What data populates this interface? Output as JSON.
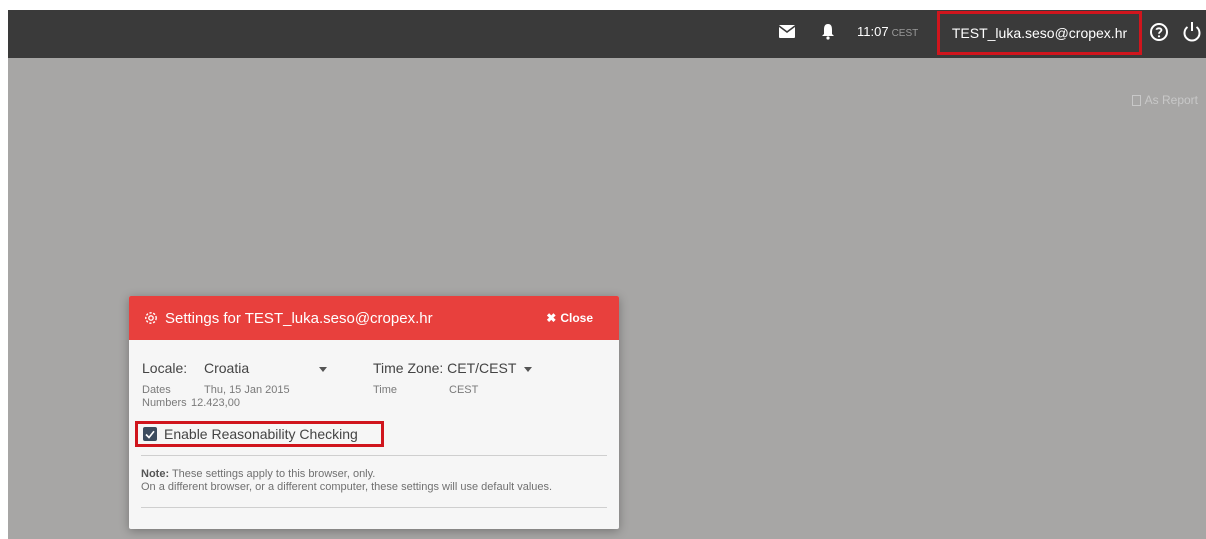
{
  "topbar": {
    "time": "11:07",
    "tz": "CEST",
    "user": "TEST_luka.seso@cropex.hr"
  },
  "content": {
    "as_report": "As Report"
  },
  "dialog": {
    "title": "Settings for TEST_luka.seso@cropex.hr",
    "close_label": "Close",
    "locale_label": "Locale:",
    "locale_value": "Croatia",
    "timezone_label": "Time Zone: CET/CEST",
    "dates_label": "Dates",
    "dates_value": "Thu, 15 Jan 2015",
    "numbers_label": "Numbers",
    "numbers_value": "12.423,00",
    "time_label": "Time",
    "time_value": "CEST",
    "checkbox_label": "Enable Reasonability Checking",
    "checkbox_checked": true,
    "note_bold": "Note:",
    "note_line1": " These settings apply to this browser, only.",
    "note_line2": "On a different browser, or a different computer, these settings will use default values."
  },
  "colors": {
    "topbar": "#3a3a3a",
    "overlay": "#a7a6a5",
    "dialog_header": "#e8403d",
    "highlight": "#d0151d"
  }
}
